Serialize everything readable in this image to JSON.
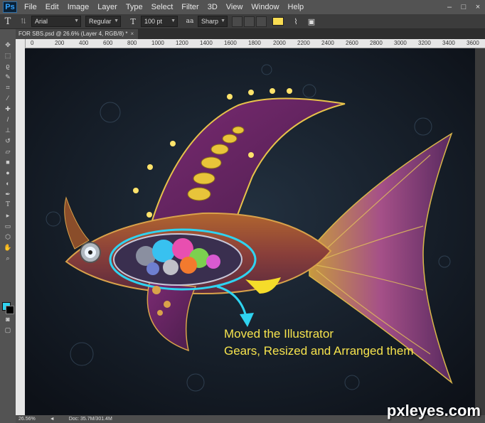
{
  "menubar": {
    "logo": "Ps",
    "items": [
      "File",
      "Edit",
      "Image",
      "Layer",
      "Type",
      "Select",
      "Filter",
      "3D",
      "View",
      "Window",
      "Help"
    ],
    "win_controls": [
      "–",
      "□",
      "×"
    ]
  },
  "options_bar": {
    "font_family": "Arial",
    "font_style": "Regular",
    "font_size": "100 pt",
    "antialias": "Sharp",
    "text_color": "#f8dc52"
  },
  "document": {
    "tab_title": "FOR SBS.psd @ 26.6% (Layer 4, RGB/8) *",
    "close": "×"
  },
  "ruler": {
    "top_ticks": [
      "0",
      "200",
      "400",
      "600",
      "800",
      "1000",
      "1200",
      "1400",
      "1600",
      "1800",
      "2000",
      "2200",
      "2400",
      "2600",
      "2800",
      "3000",
      "3200",
      "3400",
      "3600"
    ]
  },
  "tools": {
    "foreground_color": "#2fd3f0",
    "background_color": "#000000"
  },
  "status": {
    "zoom": "26.56%",
    "doc": "Doc: 35.7M/301.4M"
  },
  "canvas": {
    "annotation_line1": "Moved the Illustrator",
    "annotation_line2": "Gears, Resized and Arranged them"
  },
  "watermark": "pxleyes.com"
}
